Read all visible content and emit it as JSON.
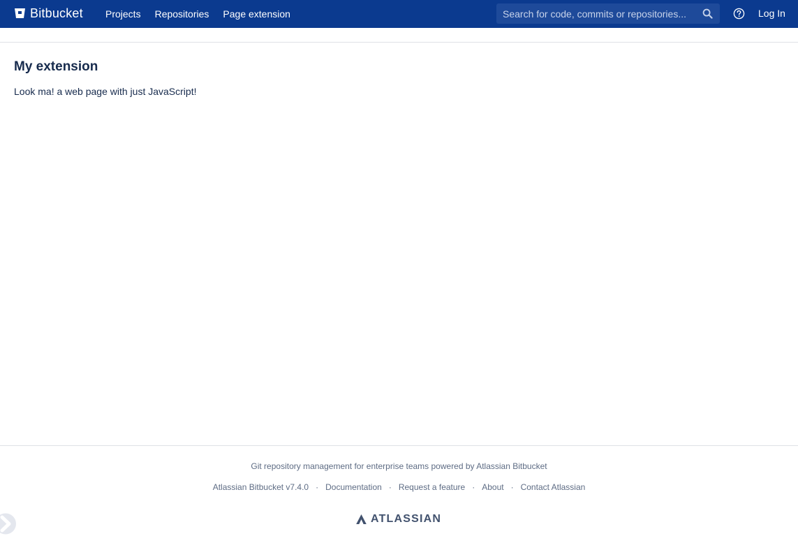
{
  "header": {
    "brand": "Bitbucket",
    "nav": [
      "Projects",
      "Repositories",
      "Page extension"
    ],
    "search_placeholder": "Search for code, commits or repositories...",
    "login_label": "Log In",
    "icons": {
      "logo": "bitbucket-logo-icon",
      "search": "search-icon",
      "help": "help-icon"
    }
  },
  "main": {
    "title": "My extension",
    "body": "Look ma! a web page with just JavaScript!"
  },
  "footer": {
    "tagline": "Git repository management for enterprise teams powered by Atlassian Bitbucket",
    "links": [
      "Atlassian Bitbucket v7.4.0",
      "Documentation",
      "Request a feature",
      "About",
      "Contact Atlassian"
    ],
    "separator": "·",
    "vendor": "ATLASSIAN"
  },
  "colors": {
    "header_bg": "#0b3a8f",
    "text": "#172b4d",
    "muted": "#5e6c84"
  }
}
